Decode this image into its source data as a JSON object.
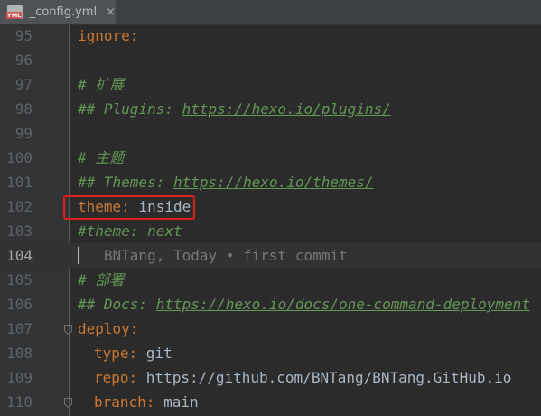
{
  "tab": {
    "title": "_config.yml",
    "icon_label": "YML",
    "icon": "yaml-file-icon",
    "close": "×"
  },
  "lines": [
    {
      "number": "95",
      "parts": [
        {
          "text": "ignore",
          "kind": "key"
        },
        {
          "text": ":",
          "kind": "punc"
        }
      ]
    },
    {
      "number": "96",
      "parts": []
    },
    {
      "number": "97",
      "parts": [
        {
          "text": "# 扩展",
          "kind": "comment"
        }
      ]
    },
    {
      "number": "98",
      "parts": [
        {
          "text": "## Plugins: ",
          "kind": "comment"
        },
        {
          "text": "https://hexo.io/plugins/",
          "kind": "comment-link"
        }
      ]
    },
    {
      "number": "99",
      "parts": []
    },
    {
      "number": "100",
      "parts": [
        {
          "text": "# 主题",
          "kind": "comment"
        }
      ]
    },
    {
      "number": "101",
      "parts": [
        {
          "text": "## Themes: ",
          "kind": "comment"
        },
        {
          "text": "https://hexo.io/themes/",
          "kind": "comment-link"
        }
      ]
    },
    {
      "number": "102",
      "parts": [
        {
          "text": "theme",
          "kind": "key"
        },
        {
          "text": ": ",
          "kind": "punc"
        },
        {
          "text": "inside",
          "kind": "val"
        }
      ]
    },
    {
      "number": "103",
      "parts": [
        {
          "text": "#theme: next",
          "kind": "comment"
        }
      ]
    },
    {
      "number": "104",
      "current": true,
      "parts": [
        {
          "text": "   BNTang, Today • first commit",
          "kind": "blame"
        }
      ]
    },
    {
      "number": "105",
      "parts": [
        {
          "text": "# 部署",
          "kind": "comment"
        }
      ]
    },
    {
      "number": "106",
      "parts": [
        {
          "text": "## Docs: ",
          "kind": "comment"
        },
        {
          "text": "https://hexo.io/docs/one-command-deployment",
          "kind": "comment-link"
        }
      ]
    },
    {
      "number": "107",
      "fold": true,
      "parts": [
        {
          "text": "deploy",
          "kind": "key"
        },
        {
          "text": ":",
          "kind": "punc"
        }
      ]
    },
    {
      "number": "108",
      "indent": true,
      "parts": [
        {
          "text": "type",
          "kind": "key"
        },
        {
          "text": ": ",
          "kind": "punc"
        },
        {
          "text": "git",
          "kind": "val"
        }
      ]
    },
    {
      "number": "109",
      "indent": true,
      "parts": [
        {
          "text": "repo",
          "kind": "key"
        },
        {
          "text": ": ",
          "kind": "punc"
        },
        {
          "text": "https://github.com/BNTang/BNTang.GitHub.io",
          "kind": "val"
        }
      ]
    },
    {
      "number": "110",
      "indent": true,
      "fold": true,
      "parts": [
        {
          "text": "branch",
          "kind": "key"
        },
        {
          "text": ": ",
          "kind": "punc"
        },
        {
          "text": "main",
          "kind": "val"
        }
      ]
    }
  ],
  "highlight": {
    "line": "102",
    "color": "#e0201c"
  },
  "colors": {
    "background": "#2b2b2b",
    "gutter": "#313335",
    "key": "#cc7832",
    "value": "#a9b7c6",
    "comment": "#629755",
    "blame": "#787878"
  }
}
